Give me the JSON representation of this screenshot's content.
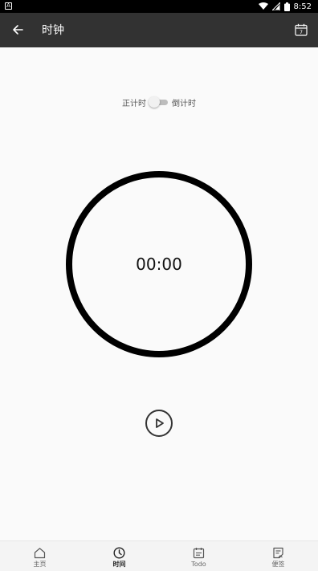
{
  "status_bar": {
    "left_icon": "A",
    "time": "8:52",
    "icons": [
      "wifi-icon",
      "signal-icon",
      "battery-icon"
    ]
  },
  "app_bar": {
    "title": "时钟",
    "back_icon": "back-arrow-icon",
    "calendar_icon": "calendar-icon",
    "calendar_day": "7"
  },
  "timer": {
    "mode_left_label": "正计时",
    "mode_right_label": "倒计时",
    "display": "00:00"
  },
  "bottom_nav": {
    "items": [
      {
        "label": "主页",
        "icon": "home-icon"
      },
      {
        "label": "时间",
        "icon": "clock-icon"
      },
      {
        "label": "Todo",
        "icon": "todo-icon"
      },
      {
        "label": "便签",
        "icon": "note-icon"
      }
    ]
  },
  "colors": {
    "app_bar": "#323232",
    "background": "#fafafa",
    "ring": "#000000"
  }
}
